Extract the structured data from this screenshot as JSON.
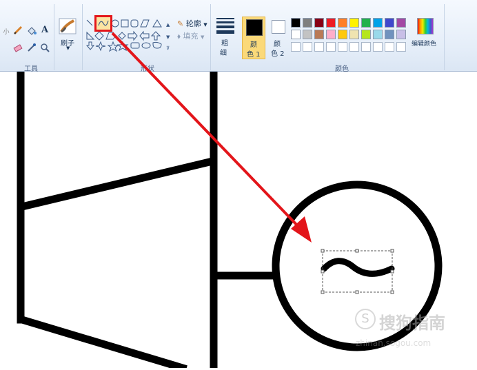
{
  "ribbon": {
    "tools_label": "工具",
    "brush_label": "刷子",
    "shapes_label": "形状",
    "outline_label": "轮廓",
    "fill_label": "填充",
    "size_label_top": "粗",
    "size_label_bottom": "细",
    "color1_label_top": "颜",
    "color1_label_bottom": "色 1",
    "color2_label_top": "颜",
    "color2_label_bottom": "色 2",
    "colors_label": "颜色",
    "edit_colors_label": "编辑颜色",
    "text_tool_glyph": "A"
  },
  "palette": {
    "row1": [
      "#000000",
      "#7f7f7f",
      "#880015",
      "#ed1c24",
      "#ff7f27",
      "#fff200",
      "#22b14c",
      "#00a2e8",
      "#3f48cc",
      "#a349a4"
    ],
    "row2": [
      "#ffffff",
      "#c3c3c3",
      "#b97a57",
      "#ffaec9",
      "#ffc90e",
      "#efe4b0",
      "#b5e61d",
      "#99d9ea",
      "#7092be",
      "#c8bfe7"
    ],
    "color1": "#000000",
    "color2": "#ffffff"
  },
  "colors": {
    "highlight": "#e3151a",
    "selected_button": "#fbd979",
    "arrow": "#e3151a"
  },
  "watermark": {
    "main": "搜狗指南",
    "sub": "zhinan.sogou.com"
  }
}
